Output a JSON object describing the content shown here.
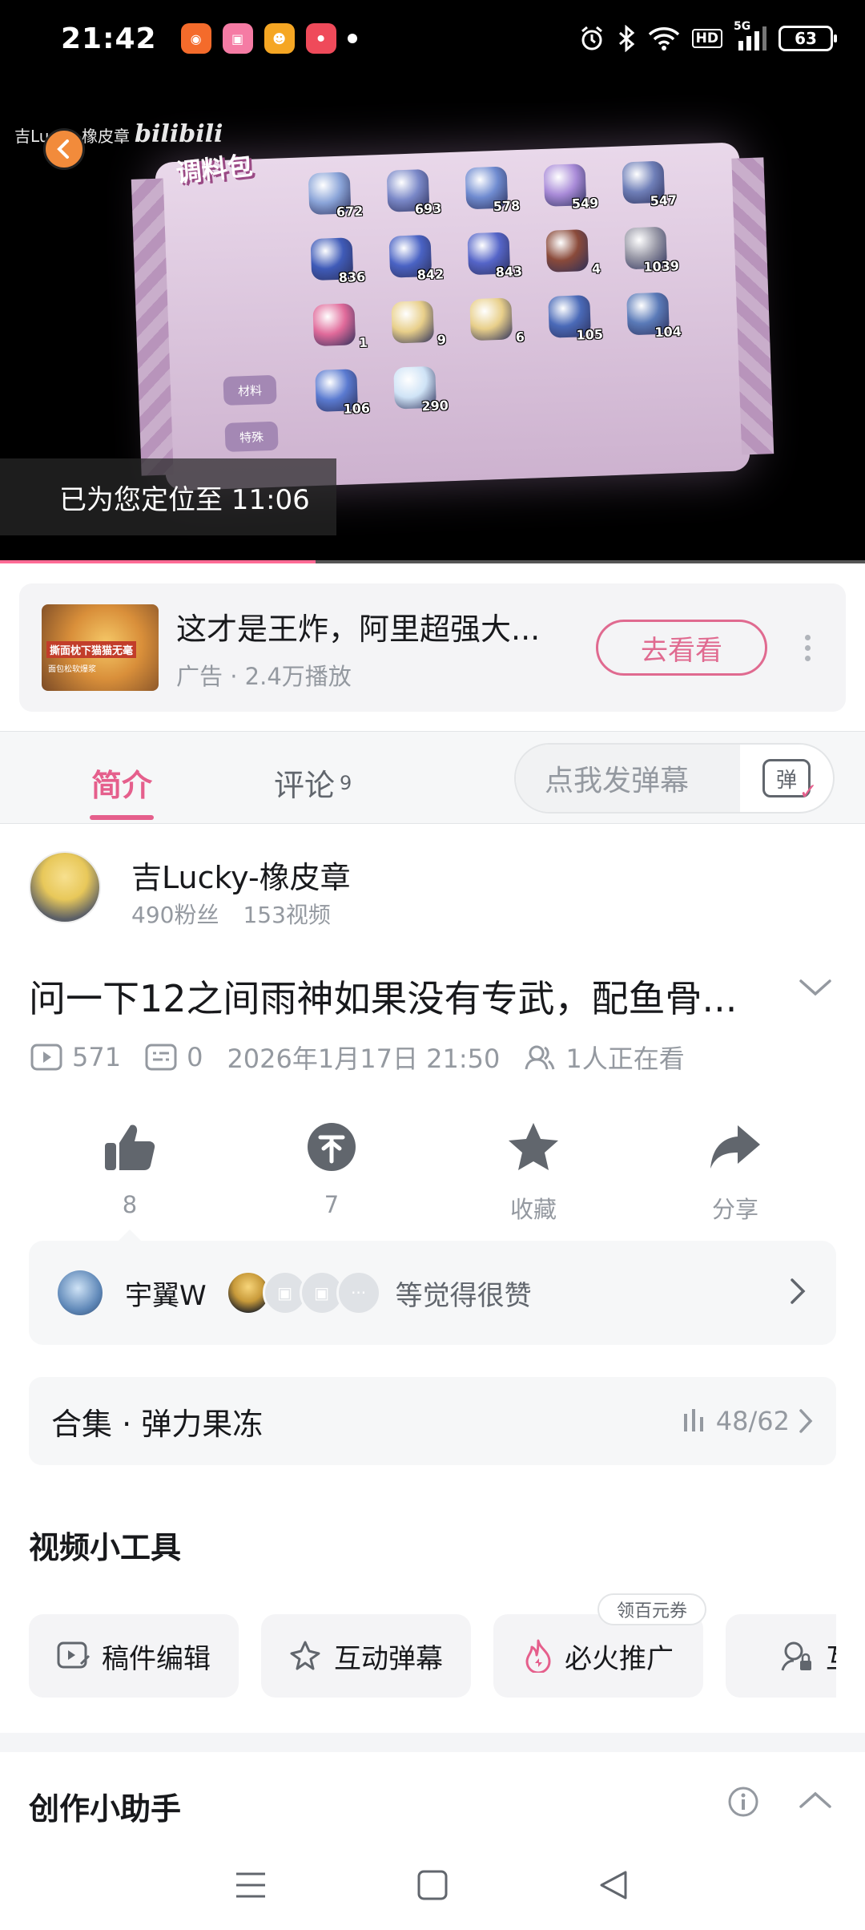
{
  "status_bar": {
    "time": "21:42",
    "battery": "63",
    "network": "5G",
    "hd": "HD"
  },
  "video": {
    "watermark_user": "吉Lucky-橡皮章",
    "watermark_brand": "bilibili",
    "frame_title": "调料包",
    "items": [
      {
        "count": "672"
      },
      {
        "count": "693"
      },
      {
        "count": "578"
      },
      {
        "count": "549"
      },
      {
        "count": "547"
      },
      {
        "count": "836"
      },
      {
        "count": "842"
      },
      {
        "count": "843"
      },
      {
        "count": "4"
      },
      {
        "count": "1039"
      },
      {
        "count": "1"
      },
      {
        "count": "9"
      },
      {
        "count": "6"
      },
      {
        "count": "105"
      },
      {
        "count": "104"
      },
      {
        "count": "106"
      },
      {
        "count": "290"
      }
    ],
    "side_tag_1": "材料",
    "side_tag_2": "特殊",
    "toast": "已为您定位至 11:06",
    "progress": 0.365
  },
  "ad": {
    "thumb_caption": "撕面枕下猫猫无毫",
    "thumb_sub": "面包松软爆浆",
    "title": "这才是王炸，阿里超强大...",
    "meta": "广告 · 2.4万播放",
    "button": "去看看"
  },
  "tabs": {
    "intro": "简介",
    "comments": "评论",
    "comments_count": "9",
    "danmaku_placeholder": "点我发弹幕",
    "danmaku_toggle": "弹"
  },
  "uploader": {
    "name": "吉Lucky-橡皮章",
    "fans": "490粉丝",
    "videos": "153视频"
  },
  "video_info": {
    "title": "问一下12之间雨神如果没有专武，配鱼骨...",
    "plays": "571",
    "danmaku": "0",
    "date": "2026年1月17日 21:50",
    "watching": "1人正在看"
  },
  "actions": {
    "like": "8",
    "coin": "7",
    "favorite": "收藏",
    "share": "分享"
  },
  "likers": {
    "name": "宇翼W",
    "text": "等觉得很赞"
  },
  "collection": {
    "label": "合集 · 弹力果冻",
    "progress": "48/62"
  },
  "tools": {
    "title": "视频小工具",
    "badge": "领百元券",
    "items": [
      {
        "label": "稿件编辑"
      },
      {
        "label": "互动弹幕"
      },
      {
        "label": "必火推广"
      },
      {
        "label": "互动"
      }
    ]
  },
  "assistant": {
    "title": "创作小助手"
  },
  "colors": {
    "accent": "#e55f8c",
    "progress": "#ff6b95",
    "muted": "#9499a0"
  }
}
